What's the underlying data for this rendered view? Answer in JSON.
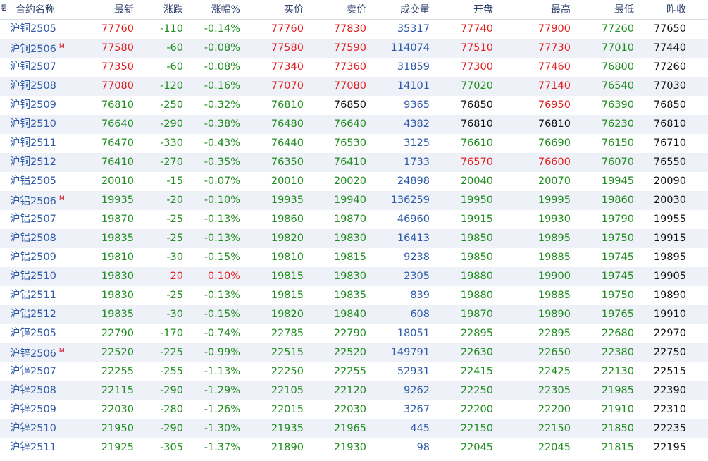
{
  "colors": {
    "up": "#e31d1d",
    "down": "#1e8c1e",
    "neutral": "#111111",
    "volume": "#2d5aa8"
  },
  "header": {
    "idx": "号",
    "name": "合约名称",
    "last": "最新",
    "change": "涨跌",
    "change_pct": "涨幅%",
    "bid": "买价",
    "ask": "卖价",
    "volume": "成交量",
    "open": "开盘",
    "high": "最高",
    "low": "最低",
    "prev_close": "昨收"
  },
  "rows": [
    {
      "name": "沪铜2505",
      "mark": "",
      "last": "77760",
      "chg": "-110",
      "pct": "-0.14%",
      "bid": "77760",
      "ask": "77830",
      "vol": "35317",
      "open": "77740",
      "high": "77900",
      "low": "77260",
      "prev": "77650"
    },
    {
      "name": "沪铜2506",
      "mark": "M",
      "last": "77580",
      "chg": "-60",
      "pct": "-0.08%",
      "bid": "77580",
      "ask": "77590",
      "vol": "114074",
      "open": "77510",
      "high": "77730",
      "low": "77010",
      "prev": "77440"
    },
    {
      "name": "沪铜2507",
      "mark": "",
      "last": "77350",
      "chg": "-60",
      "pct": "-0.08%",
      "bid": "77340",
      "ask": "77360",
      "vol": "31859",
      "open": "77300",
      "high": "77460",
      "low": "76800",
      "prev": "77260"
    },
    {
      "name": "沪铜2508",
      "mark": "",
      "last": "77080",
      "chg": "-120",
      "pct": "-0.16%",
      "bid": "77070",
      "ask": "77080",
      "vol": "14101",
      "open": "77020",
      "high": "77140",
      "low": "76540",
      "prev": "77030"
    },
    {
      "name": "沪铜2509",
      "mark": "",
      "last": "76810",
      "chg": "-250",
      "pct": "-0.32%",
      "bid": "76810",
      "ask": "76850",
      "vol": "9365",
      "open": "76850",
      "high": "76950",
      "low": "76390",
      "prev": "76850"
    },
    {
      "name": "沪铜2510",
      "mark": "",
      "last": "76640",
      "chg": "-290",
      "pct": "-0.38%",
      "bid": "76480",
      "ask": "76640",
      "vol": "4382",
      "open": "76810",
      "high": "76810",
      "low": "76230",
      "prev": "76810"
    },
    {
      "name": "沪铜2511",
      "mark": "",
      "last": "76470",
      "chg": "-330",
      "pct": "-0.43%",
      "bid": "76440",
      "ask": "76530",
      "vol": "3125",
      "open": "76610",
      "high": "76690",
      "low": "76150",
      "prev": "76710"
    },
    {
      "name": "沪铜2512",
      "mark": "",
      "last": "76410",
      "chg": "-270",
      "pct": "-0.35%",
      "bid": "76350",
      "ask": "76410",
      "vol": "1733",
      "open": "76570",
      "high": "76600",
      "low": "76070",
      "prev": "76550"
    },
    {
      "name": "沪铝2505",
      "mark": "",
      "last": "20010",
      "chg": "-15",
      "pct": "-0.07%",
      "bid": "20010",
      "ask": "20020",
      "vol": "24898",
      "open": "20040",
      "high": "20070",
      "low": "19945",
      "prev": "20090"
    },
    {
      "name": "沪铝2506",
      "mark": "M",
      "last": "19935",
      "chg": "-20",
      "pct": "-0.10%",
      "bid": "19935",
      "ask": "19940",
      "vol": "136259",
      "open": "19950",
      "high": "19995",
      "low": "19860",
      "prev": "20030"
    },
    {
      "name": "沪铝2507",
      "mark": "",
      "last": "19870",
      "chg": "-25",
      "pct": "-0.13%",
      "bid": "19860",
      "ask": "19870",
      "vol": "46960",
      "open": "19915",
      "high": "19930",
      "low": "19790",
      "prev": "19955"
    },
    {
      "name": "沪铝2508",
      "mark": "",
      "last": "19835",
      "chg": "-25",
      "pct": "-0.13%",
      "bid": "19820",
      "ask": "19830",
      "vol": "16413",
      "open": "19850",
      "high": "19895",
      "low": "19750",
      "prev": "19915"
    },
    {
      "name": "沪铝2509",
      "mark": "",
      "last": "19810",
      "chg": "-30",
      "pct": "-0.15%",
      "bid": "19810",
      "ask": "19815",
      "vol": "9238",
      "open": "19850",
      "high": "19885",
      "low": "19745",
      "prev": "19895"
    },
    {
      "name": "沪铝2510",
      "mark": "",
      "last": "19830",
      "chg": "20",
      "pct": "0.10%",
      "bid": "19815",
      "ask": "19830",
      "vol": "2305",
      "open": "19880",
      "high": "19900",
      "low": "19745",
      "prev": "19905"
    },
    {
      "name": "沪铝2511",
      "mark": "",
      "last": "19830",
      "chg": "-25",
      "pct": "-0.13%",
      "bid": "19815",
      "ask": "19835",
      "vol": "839",
      "open": "19880",
      "high": "19885",
      "low": "19750",
      "prev": "19890"
    },
    {
      "name": "沪铝2512",
      "mark": "",
      "last": "19835",
      "chg": "-30",
      "pct": "-0.15%",
      "bid": "19820",
      "ask": "19840",
      "vol": "608",
      "open": "19870",
      "high": "19890",
      "low": "19765",
      "prev": "19910"
    },
    {
      "name": "沪锌2505",
      "mark": "",
      "last": "22790",
      "chg": "-170",
      "pct": "-0.74%",
      "bid": "22785",
      "ask": "22790",
      "vol": "18051",
      "open": "22895",
      "high": "22895",
      "low": "22680",
      "prev": "22970"
    },
    {
      "name": "沪锌2506",
      "mark": "M",
      "last": "22520",
      "chg": "-225",
      "pct": "-0.99%",
      "bid": "22515",
      "ask": "22520",
      "vol": "149791",
      "open": "22630",
      "high": "22650",
      "low": "22380",
      "prev": "22750"
    },
    {
      "name": "沪锌2507",
      "mark": "",
      "last": "22255",
      "chg": "-255",
      "pct": "-1.13%",
      "bid": "22250",
      "ask": "22255",
      "vol": "52931",
      "open": "22415",
      "high": "22425",
      "low": "22130",
      "prev": "22515"
    },
    {
      "name": "沪锌2508",
      "mark": "",
      "last": "22115",
      "chg": "-290",
      "pct": "-1.29%",
      "bid": "22105",
      "ask": "22120",
      "vol": "9262",
      "open": "22250",
      "high": "22305",
      "low": "21985",
      "prev": "22390"
    },
    {
      "name": "沪锌2509",
      "mark": "",
      "last": "22030",
      "chg": "-280",
      "pct": "-1.26%",
      "bid": "22015",
      "ask": "22030",
      "vol": "3267",
      "open": "22200",
      "high": "22200",
      "low": "21910",
      "prev": "22310"
    },
    {
      "name": "沪锌2510",
      "mark": "",
      "last": "21950",
      "chg": "-290",
      "pct": "-1.30%",
      "bid": "21935",
      "ask": "21965",
      "vol": "445",
      "open": "22150",
      "high": "22150",
      "low": "21850",
      "prev": "22235"
    },
    {
      "name": "沪锌2511",
      "mark": "",
      "last": "21925",
      "chg": "-305",
      "pct": "-1.37%",
      "bid": "21890",
      "ask": "21930",
      "vol": "98",
      "open": "22045",
      "high": "22045",
      "low": "21815",
      "prev": "22195"
    }
  ]
}
